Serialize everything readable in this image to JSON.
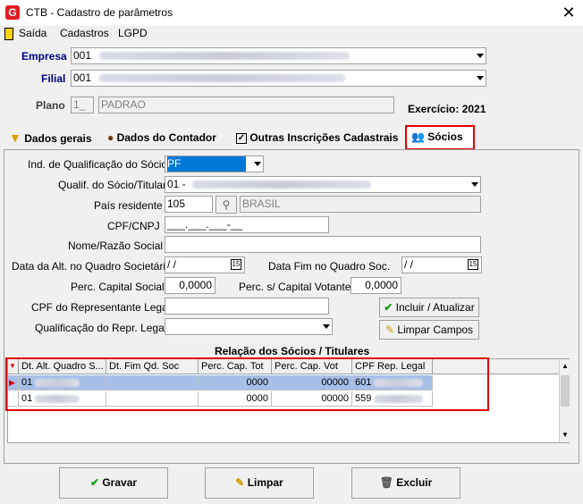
{
  "window": {
    "title": "CTB - Cadastro de parâmetros",
    "close": "✕"
  },
  "menu": {
    "items": [
      "Saída",
      "Cadastros",
      "LGPD"
    ]
  },
  "header": {
    "empresa_label": "Empresa",
    "empresa_value": "001",
    "filial_label": "Filial",
    "filial_value": "001",
    "plano_label": "Plano",
    "plano_code": "1_",
    "plano_value": "PADRAO",
    "exercicio_label": "Exercício: 2021"
  },
  "tabs": [
    "Dados gerais",
    "Dados do Contador",
    "Outras Inscrições Cadastrais",
    "Sócios"
  ],
  "form": {
    "qualif_socio_label": "Ind. de Qualificação do Sócio",
    "qualif_socio_value": "PF",
    "qualif_titular_label": "Qualif. do Sócio/Titular",
    "qualif_titular_value": "01 -",
    "pais_label": "País residente",
    "pais_code": "105",
    "pais_name": "BRASIL",
    "cpf_label": "CPF/CNPJ",
    "cpf_value": "___.___.___-__",
    "nome_label": "Nome/Razão Social",
    "dt_alt_label": "Data da Alt. no Quadro Societário",
    "dt_alt_value": " /  /",
    "dt_fim_label": "Data Fim no Quadro Soc.",
    "dt_fim_value": " /  /",
    "cap_social_label": "Perc. Capital Social",
    "cap_social_value": "0,0000",
    "cap_votante_label": "Perc. s/ Capital Votante",
    "cap_votante_value": "0,0000",
    "cpf_rep_label": "CPF do Representante Legal",
    "qualif_rep_label": "Qualificação do Repr. Legal",
    "calendar_icon": "15"
  },
  "buttons": {
    "incluir": "Incluir / Atualizar",
    "limpar_campos": "Limpar Campos",
    "gravar": "Gravar",
    "limpar": "Limpar",
    "excluir": "Excluir"
  },
  "grid": {
    "title": "Relação dos Sócios / Titulares",
    "columns": [
      "Dt. Alt. Quadro S...",
      "Dt. Fim Qd. Soc",
      "Perc. Cap. Tot",
      "Perc. Cap. Vot",
      "CPF Rep. Legal"
    ],
    "sort_marker": "1",
    "rows": [
      {
        "dt_alt": "01",
        "dt_fim": "",
        "cap_tot": "0000",
        "cap_vot": "00000",
        "cpf_rep": "601"
      },
      {
        "dt_alt": "01",
        "dt_fim": "",
        "cap_tot": "0000",
        "cap_vot": "00000",
        "cpf_rep": "559"
      }
    ]
  }
}
